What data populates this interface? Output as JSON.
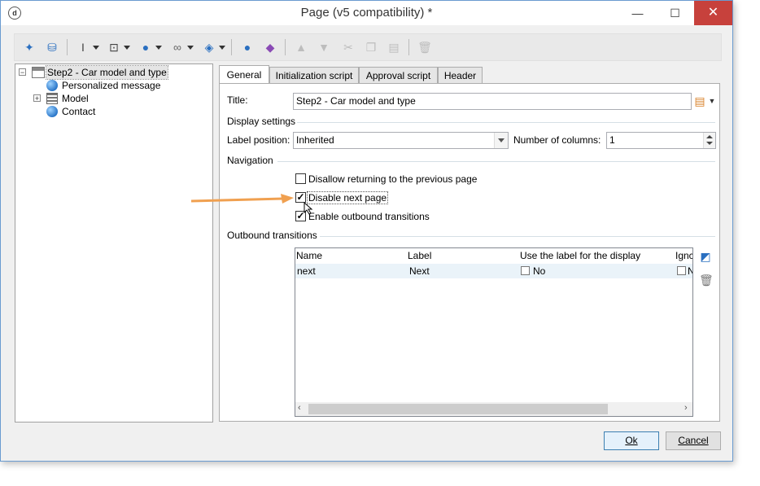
{
  "window": {
    "title": "Page (v5 compatibility) *",
    "minimize": "—",
    "maximize": "☐",
    "close": "✕"
  },
  "toolbar": {
    "icons": [
      "wizard-icon",
      "database-icon",
      "text-cursor-icon",
      "add-element-icon",
      "globe-icon",
      "link-icon",
      "box-icon",
      "person-icon",
      "shapes-icon",
      "arrow-up-icon",
      "arrow-down-icon",
      "cut-icon",
      "copy-icon",
      "paste-icon",
      "delete-icon"
    ]
  },
  "tree": {
    "root": "Step2 - Car model and type",
    "items": [
      "Personalized message",
      "Model",
      "Contact"
    ]
  },
  "tabs": [
    "General",
    "Initialization script",
    "Approval script",
    "Header"
  ],
  "general": {
    "title_label": "Title:",
    "title_value": "Step2 - Car model and type",
    "display_settings": "Display settings",
    "label_position_label": "Label position:",
    "label_position_value": "Inherited",
    "columns_label": "Number of columns:",
    "columns_value": "1",
    "navigation": "Navigation",
    "options": [
      {
        "label": "Disallow returning to the previous page",
        "checked": false
      },
      {
        "label": "Disable next page",
        "checked": true
      },
      {
        "label": "Enable outbound transitions",
        "checked": true
      }
    ],
    "outbound": "Outbound transitions",
    "grid": {
      "headers": [
        "Name",
        "Label",
        "Use the label for the display",
        "Ignc"
      ],
      "rows": [
        [
          "next",
          "Next",
          "No",
          "N"
        ]
      ]
    }
  },
  "buttons": {
    "ok": "Ok",
    "cancel": "Cancel"
  },
  "colors": {
    "close": "#c7413c",
    "arrow": "#f0a050",
    "selection": "#eaf3f9"
  }
}
